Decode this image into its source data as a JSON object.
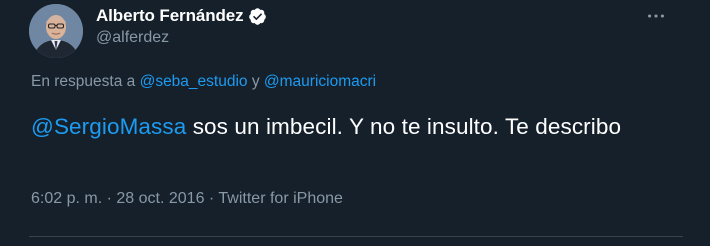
{
  "author": {
    "name": "Alberto Fernández",
    "handle": "@alferdez"
  },
  "reply": {
    "prefix": "En respuesta a",
    "mention1": "@seba_estudio",
    "connector": "y",
    "mention2": "@mauriciomacri"
  },
  "tweet": {
    "mention": "@SergioMassa",
    "text": " sos un imbecil. Y no te insulto. Te describo"
  },
  "meta": {
    "time": "6:02 p. m.",
    "separator": "·",
    "date": "28 oct. 2016",
    "source": "Twitter for iPhone"
  },
  "icons": {
    "verified": "verified-badge-icon",
    "more": "more-dots-icon"
  },
  "colors": {
    "background": "#15202b",
    "link": "#1d9bf0",
    "secondary_text": "#8899a6",
    "primary_text": "#ffffff",
    "divider": "#38444d"
  }
}
